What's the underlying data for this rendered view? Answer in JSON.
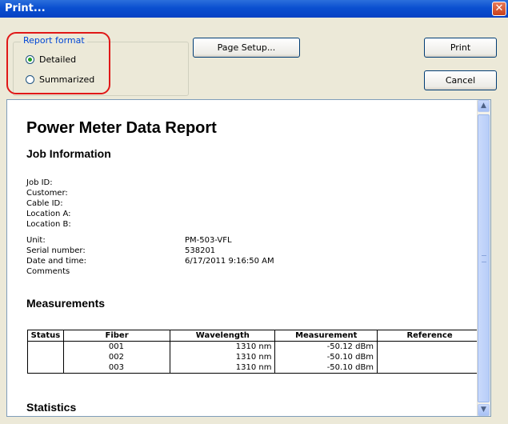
{
  "window": {
    "title": "Print...",
    "close_glyph": "✕"
  },
  "report_format": {
    "legend": "Report format",
    "options": [
      {
        "label": "Detailed",
        "checked": true
      },
      {
        "label": "Summarized",
        "checked": false
      }
    ]
  },
  "buttons": {
    "page_setup": "Page Setup...",
    "print": "Print",
    "cancel": "Cancel"
  },
  "report": {
    "title": "Power Meter Data Report",
    "job_heading": "Job Information",
    "fields": [
      {
        "label": "Job ID:",
        "value": ""
      },
      {
        "label": "Customer:",
        "value": ""
      },
      {
        "label": "Cable ID:",
        "value": ""
      },
      {
        "label": "Location A:",
        "value": ""
      },
      {
        "label": "Location B:",
        "value": ""
      },
      {
        "label": "Unit:",
        "value": "PM-503-VFL"
      },
      {
        "label": "Serial number:",
        "value": "538201"
      },
      {
        "label": "Date and time:",
        "value": "6/17/2011 9:16:50 AM"
      },
      {
        "label": "Comments",
        "value": ""
      }
    ],
    "measurements_heading": "Measurements",
    "table": {
      "headers": [
        "Status",
        "Fiber",
        "Wavelength",
        "Measurement",
        "Reference"
      ],
      "rows": [
        [
          "",
          "001",
          "1310 nm",
          "-50.12 dBm",
          ""
        ],
        [
          "",
          "002",
          "1310 nm",
          "-50.10 dBm",
          ""
        ],
        [
          "",
          "003",
          "1310 nm",
          "-50.10 dBm",
          ""
        ]
      ]
    },
    "statistics_heading": "Statistics"
  },
  "colors": {
    "title_bar": "#0a4fd0",
    "highlight": "#e01818",
    "legend_text": "#0046d5"
  }
}
